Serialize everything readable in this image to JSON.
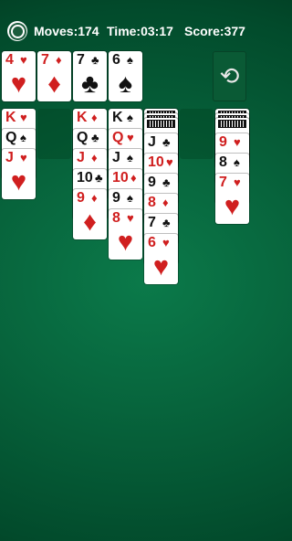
{
  "header": {
    "moves_label": "Moves:174",
    "time_label": "Time:03:17",
    "score_label": "Score:377",
    "settings_icon": "gear-icon"
  },
  "foundations": [
    {
      "rank": "4",
      "suit": "♥",
      "color": "red"
    },
    {
      "rank": "7",
      "suit": "♦",
      "color": "red"
    },
    {
      "rank": "7",
      "suit": "♣",
      "color": "black"
    },
    {
      "rank": "6",
      "suit": "♠",
      "color": "black"
    }
  ],
  "undo_icon": "undo-icon",
  "undo_glyph": "⟲",
  "tableau": [
    {
      "cards": [
        {
          "rank": "K",
          "suit": "♥",
          "color": "red"
        },
        {
          "rank": "Q",
          "suit": "♠",
          "color": "black"
        },
        {
          "rank": "J",
          "suit": "♥",
          "color": "red"
        }
      ]
    },
    {
      "cards": []
    },
    {
      "cards": [
        {
          "rank": "K",
          "suit": "♦",
          "color": "red"
        },
        {
          "rank": "Q",
          "suit": "♣",
          "color": "black"
        },
        {
          "rank": "J",
          "suit": "♦",
          "color": "red"
        },
        {
          "rank": "10",
          "suit": "♣",
          "color": "black"
        },
        {
          "rank": "9",
          "suit": "♦",
          "color": "red"
        }
      ]
    },
    {
      "cards": [
        {
          "rank": "K",
          "suit": "♠",
          "color": "black"
        },
        {
          "rank": "Q",
          "suit": "♥",
          "color": "red"
        },
        {
          "rank": "J",
          "suit": "♠",
          "color": "black"
        },
        {
          "rank": "10",
          "suit": "♦",
          "color": "red"
        },
        {
          "rank": "9",
          "suit": "♠",
          "color": "black"
        },
        {
          "rank": "8",
          "suit": "♥",
          "color": "red"
        }
      ]
    },
    {
      "facedown": 3,
      "cards": [
        {
          "rank": "J",
          "suit": "♣",
          "color": "black"
        },
        {
          "rank": "10",
          "suit": "♥",
          "color": "red"
        },
        {
          "rank": "9",
          "suit": "♣",
          "color": "black"
        },
        {
          "rank": "8",
          "suit": "♦",
          "color": "red"
        },
        {
          "rank": "7",
          "suit": "♣",
          "color": "black"
        },
        {
          "rank": "6",
          "suit": "♥",
          "color": "red"
        }
      ]
    },
    {
      "cards": []
    },
    {
      "facedown": 3,
      "cards": [
        {
          "rank": "9",
          "suit": "♥",
          "color": "red"
        },
        {
          "rank": "8",
          "suit": "♠",
          "color": "black"
        },
        {
          "rank": "7",
          "suit": "♥",
          "color": "red"
        }
      ]
    }
  ]
}
